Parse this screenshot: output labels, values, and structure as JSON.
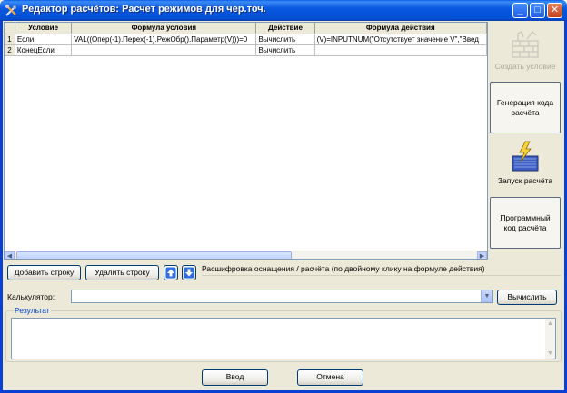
{
  "window": {
    "title": "Редактор расчётов: Расчет режимов для чер.точ.",
    "minimize": "_",
    "maximize": "□",
    "close": "✕"
  },
  "grid": {
    "columns": [
      "Условие",
      "Формула условия",
      "Действие",
      "Формула действия"
    ],
    "rows": [
      {
        "num": "1",
        "condition": "Если",
        "condition_formula": "VAL((Опер(-1).Перех(-1).РежОбр().Параметр(V)))=0",
        "action": "Вычислить",
        "action_formula": "(V)=INPUTNUM(\"Отсутствует значение V\",\"Введ"
      },
      {
        "num": "2",
        "condition": "КонецЕсли",
        "condition_formula": "",
        "action": "Вычислить",
        "action_formula": ""
      }
    ]
  },
  "right_panel": {
    "create_condition": "Создать условие",
    "generate_code": "Генерация кода расчёта",
    "run_calc": "Запуск расчёта",
    "program_code": "Программный код расчёта"
  },
  "toolbar": {
    "add_row": "Добавить строку",
    "delete_row": "Удалить строку",
    "decode_label": "Расшифровка оснащения / расчёта (по двойному клику на формуле действия)"
  },
  "calculator": {
    "label": "Калькулятор:",
    "value": "",
    "compute": "Вычислить"
  },
  "result": {
    "title": "Результат",
    "value": ""
  },
  "footer": {
    "ok": "Ввод",
    "cancel": "Отмена"
  },
  "colors": {
    "title_bar": "#0350d3",
    "window_bg": "#ece9d8",
    "group_title": "#0046d5"
  }
}
